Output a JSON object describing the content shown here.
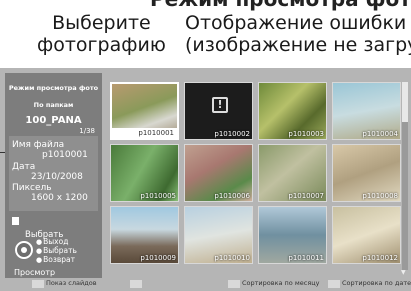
{
  "page": {
    "heading": "Режим просмотра фото"
  },
  "callouts": {
    "left": [
      "Выберите",
      "фотографию"
    ],
    "right": [
      "Отображение ошибки",
      "(изображение не загру"
    ]
  },
  "panel": {
    "mode": "Режим просмотра фото",
    "folder_mode": "По папкам",
    "folder_name": "100_PANA",
    "count": "1/38",
    "file_label": "Имя файла",
    "file_value": "p1010001",
    "date_label": "Дата",
    "date_value": "23/10/2008",
    "pixel_label": "Пиксель",
    "pixel_value": "1600 x 1200",
    "select_title": "Выбрать",
    "actions": [
      "Выход",
      "Выбрать",
      "Возврат"
    ],
    "view": "Просмотр"
  },
  "thumbnails": [
    {
      "name": "p1010001",
      "selected": true,
      "error": false,
      "icon": "photo"
    },
    {
      "name": "p1010002",
      "selected": false,
      "error": true,
      "icon": "error-icon"
    },
    {
      "name": "p1010003",
      "selected": false,
      "error": false,
      "icon": "photo"
    },
    {
      "name": "p1010004",
      "selected": false,
      "error": false,
      "icon": "photo"
    },
    {
      "name": "p1010005",
      "selected": false,
      "error": false,
      "icon": "photo"
    },
    {
      "name": "p1010006",
      "selected": false,
      "error": false,
      "icon": "photo"
    },
    {
      "name": "p1010007",
      "selected": false,
      "error": false,
      "icon": "photo"
    },
    {
      "name": "p1010008",
      "selected": false,
      "error": false,
      "icon": "photo"
    },
    {
      "name": "p1010009",
      "selected": false,
      "error": false,
      "icon": "photo"
    },
    {
      "name": "p1010010",
      "selected": false,
      "error": false,
      "icon": "photo"
    },
    {
      "name": "p1010011",
      "selected": false,
      "error": false,
      "icon": "photo"
    },
    {
      "name": "p1010012",
      "selected": false,
      "error": false,
      "icon": "photo"
    }
  ],
  "bottom_bar": {
    "slideshow": "Показ слайдов",
    "sort_month": "Сортировка по месяцу",
    "sort_date": "Сортировка по дате"
  },
  "colors": {
    "screen_bg": "#b5b5b5",
    "panel_bg": "#7d7d7d",
    "key_red": "#d9d9d9",
    "key_green": "#d9d9d9",
    "key_yellow": "#d9d9d9",
    "key_blue": "#d9d9d9"
  }
}
